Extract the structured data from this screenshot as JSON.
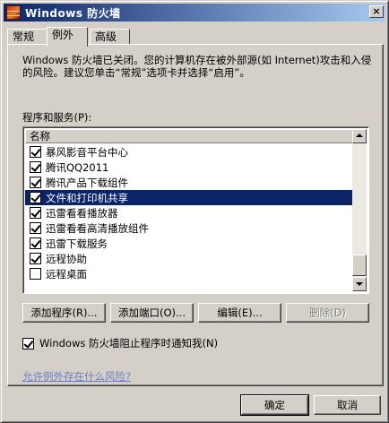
{
  "window": {
    "title": "Windows 防火墙",
    "close_label": "×"
  },
  "tabs": [
    {
      "label": "常规",
      "active": false
    },
    {
      "label": "例外",
      "active": true
    },
    {
      "label": "高级",
      "active": false
    }
  ],
  "info_text": "Windows 防火墙已关闭。您的计算机存在被外部源(如 Internet)攻击和入侵的风险。建议您单击“常规”选项卡并选择“启用”。",
  "programs": {
    "label": "程序和服务(P):",
    "column_header": "名称",
    "items": [
      {
        "label": "暴风影音平台中心",
        "checked": true,
        "selected": false
      },
      {
        "label": "腾讯QQ2011",
        "checked": true,
        "selected": false
      },
      {
        "label": "腾讯产品下载组件",
        "checked": true,
        "selected": false
      },
      {
        "label": "文件和打印机共享",
        "checked": true,
        "selected": true
      },
      {
        "label": "迅雷看看播放器",
        "checked": true,
        "selected": false
      },
      {
        "label": "迅雷看看高清播放组件",
        "checked": true,
        "selected": false
      },
      {
        "label": "迅雷下载服务",
        "checked": true,
        "selected": false
      },
      {
        "label": "远程协助",
        "checked": true,
        "selected": false
      },
      {
        "label": "远程桌面",
        "checked": false,
        "selected": false
      }
    ]
  },
  "actions": {
    "add_program": "添加程序(R)...",
    "add_port": "添加端口(O)...",
    "edit": "编辑(E)...",
    "delete": "删除(D)"
  },
  "notify": {
    "label": "Windows 防火墙阻止程序时通知我(N)",
    "checked": true
  },
  "risk_link": "允许例外存在什么风险?",
  "dialog": {
    "ok": "确定",
    "cancel": "取消"
  }
}
